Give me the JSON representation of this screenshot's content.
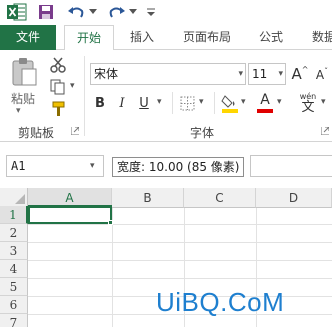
{
  "ribbon_tabs": {
    "file": "文件",
    "home": "开始",
    "insert": "插入",
    "page_layout": "页面布局",
    "formulas": "公式",
    "data": "数据"
  },
  "clipboard": {
    "paste_label": "粘贴",
    "group_label": "剪贴板"
  },
  "font_group": {
    "font_name": "宋体",
    "font_size": "11",
    "group_label": "字体",
    "bold": "B",
    "italic": "I",
    "underline": "U",
    "grow": "A",
    "shrink": "A",
    "wen": "wén",
    "wen_char": "文",
    "font_color_letter": "A"
  },
  "formula_bar": {
    "name_box": "A1",
    "tooltip": "宽度: 10.00 (85 像素)"
  },
  "sheet": {
    "columns": [
      "A",
      "B",
      "C",
      "D"
    ],
    "rows": [
      "1",
      "2",
      "3",
      "4",
      "5",
      "6",
      "7"
    ]
  },
  "watermark": "UiBQ.CoM",
  "colors": {
    "accent": "#217346",
    "fill_yellow": "#ffd600",
    "font_red": "#e00000",
    "watermark": "#1e7fcf"
  }
}
